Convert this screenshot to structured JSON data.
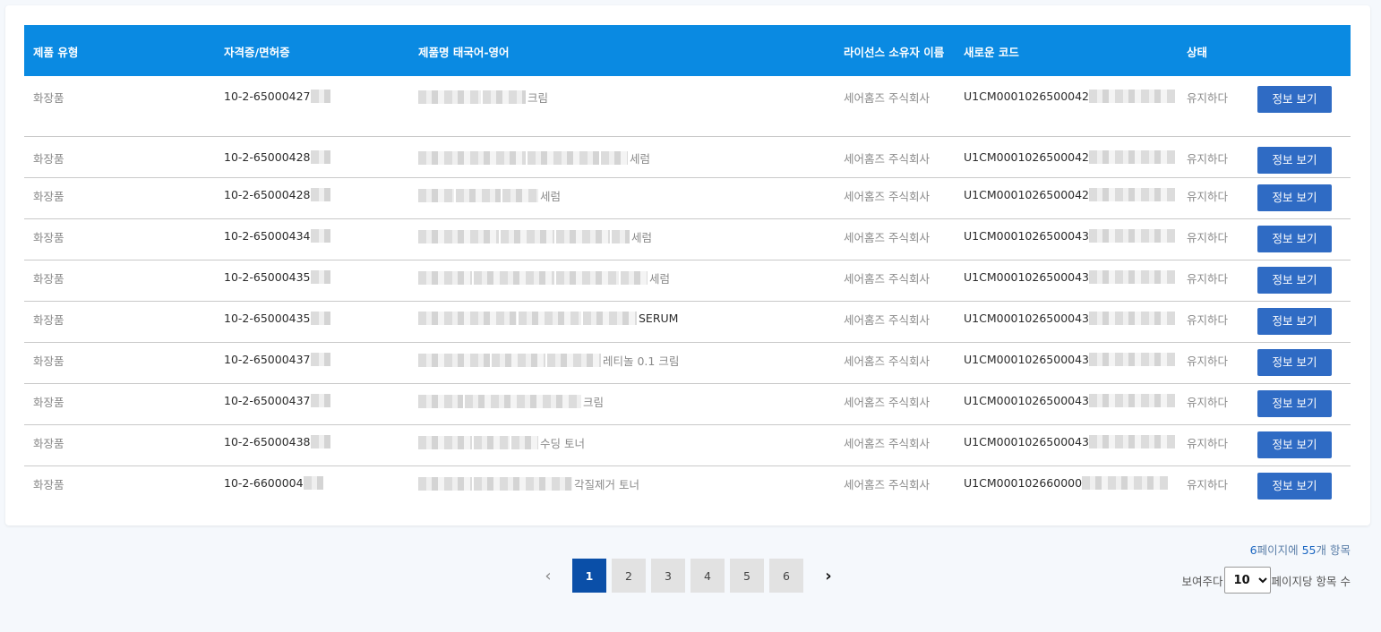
{
  "table": {
    "headers": [
      "제품 유형",
      "자격증/면허증",
      "제품명 태국어-영어",
      "라이선스 소유자 이름",
      "새로운 코드",
      "상태"
    ],
    "rows": [
      {
        "type": "화장품",
        "license": "10-2-65000427",
        "name": "크림",
        "owner": "세어홈즈 주식회사",
        "code": "U1CM0001026500042",
        "status": "유지하다",
        "button": "정보 보기"
      },
      {
        "type": "화장품",
        "license": "10-2-65000428",
        "name": "세럼",
        "owner": "세어홈즈 주식회사",
        "code": "U1CM0001026500042",
        "status": "유지하다",
        "button": "정보 보기"
      },
      {
        "type": "화장품",
        "license": "10-2-65000428",
        "name": "세럼",
        "owner": "세어홈즈 주식회사",
        "code": "U1CM0001026500042",
        "status": "유지하다",
        "button": "정보 보기"
      },
      {
        "type": "화장품",
        "license": "10-2-65000434",
        "name": "세럼",
        "owner": "세어홈즈 주식회사",
        "code": "U1CM0001026500043",
        "status": "유지하다",
        "button": "정보 보기"
      },
      {
        "type": "화장품",
        "license": "10-2-65000435",
        "name": "세럼",
        "owner": "세어홈즈 주식회사",
        "code": "U1CM0001026500043",
        "status": "유지하다",
        "button": "정보 보기"
      },
      {
        "type": "화장품",
        "license": "10-2-65000435",
        "name": "SERUM",
        "owner": "세어홈즈 주식회사",
        "code": "U1CM0001026500043",
        "status": "유지하다",
        "button": "정보 보기"
      },
      {
        "type": "화장품",
        "license": "10-2-65000437",
        "name": "레티놀 0.1 크림",
        "owner": "세어홈즈 주식회사",
        "code": "U1CM0001026500043",
        "status": "유지하다",
        "button": "정보 보기"
      },
      {
        "type": "화장품",
        "license": "10-2-65000437",
        "name": "크림",
        "owner": "세어홈즈 주식회사",
        "code": "U1CM0001026500043",
        "status": "유지하다",
        "button": "정보 보기"
      },
      {
        "type": "화장품",
        "license": "10-2-65000438",
        "name": "수딩 토너",
        "owner": "세어홈즈 주식회사",
        "code": "U1CM0001026500043",
        "status": "유지하다",
        "button": "정보 보기"
      },
      {
        "type": "화장품",
        "license": "10-2-6600004",
        "name": "각질제거 토너",
        "owner": "세어홈즈 주식회사",
        "code": "U1CM000102660000",
        "status": "유지하다",
        "button": "정보 보기"
      }
    ]
  },
  "pagination": {
    "prev": "‹",
    "next": "›",
    "pages": [
      "1",
      "2",
      "3",
      "4",
      "5",
      "6"
    ],
    "active": "1"
  },
  "summary": {
    "page_count": "6",
    "pages_suffix": "페이지에",
    "item_count": "55",
    "items_suffix": "개 항목"
  },
  "per_page": {
    "prefix": "보여주다",
    "value": "10",
    "suffix": "페이지당 항목 수"
  },
  "colors": {
    "header_bg": "#0a8ae2",
    "button_bg": "#2f6bc4",
    "active_page": "#0a4fa8"
  }
}
